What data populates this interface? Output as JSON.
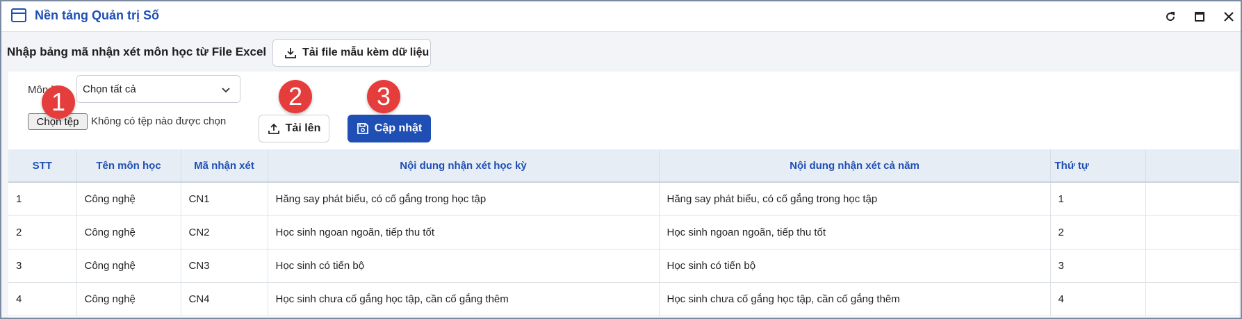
{
  "window": {
    "title": "Nền tảng Quản trị Số"
  },
  "toolbar": {
    "heading": "Nhập bảng mã nhận xét môn học từ File Excel",
    "template_button": "Tải file mẫu kèm dữ liệu"
  },
  "filter": {
    "subject_label": "Môn học",
    "subject_value": "Chọn tất cả"
  },
  "file": {
    "choose_button": "Chọn tệp",
    "status": "Không có tệp nào được chọn"
  },
  "actions": {
    "upload": "Tải lên",
    "update": "Cập nhật"
  },
  "markers": [
    "1",
    "2",
    "3"
  ],
  "colors": {
    "brand": "#1f4fb5",
    "marker": "#e53c3c",
    "header_bg": "#e7edf5"
  },
  "table": {
    "columns": [
      "STT",
      "Tên môn học",
      "Mã nhận xét",
      "Nội dung nhận xét học kỳ",
      "Nội dung nhận xét cả năm",
      "Thứ tự",
      ""
    ],
    "rows": [
      [
        "1",
        "Công nghệ",
        "CN1",
        "Hăng say phát biểu, có cố gắng trong học tập",
        "Hăng say phát biểu, có cố gắng trong học tập",
        "1",
        ""
      ],
      [
        "2",
        "Công nghệ",
        "CN2",
        "Học sinh ngoan ngoãn, tiếp thu tốt",
        "Học sinh ngoan ngoãn, tiếp thu tốt",
        "2",
        ""
      ],
      [
        "3",
        "Công nghệ",
        "CN3",
        "Học sinh có tiến bộ",
        "Học sinh có tiến bộ",
        "3",
        ""
      ],
      [
        "4",
        "Công nghệ",
        "CN4",
        "Học sinh chưa cố gắng học tập, cần cố gắng thêm",
        "Học sinh chưa cố gắng học tập, cần cố gắng thêm",
        "4",
        ""
      ]
    ]
  }
}
